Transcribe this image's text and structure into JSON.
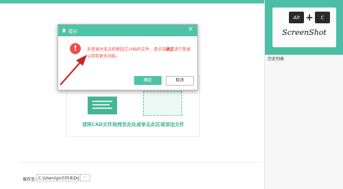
{
  "colors": {
    "accent": "#4fc3a8",
    "error": "#ef4d4d",
    "arrow": "#c82424"
  },
  "sidebar": {
    "logo": {
      "key_alt": "Alt",
      "key_c": "C",
      "plus": "+",
      "text": "ScreenShot"
    },
    "history_label": "历史列表"
  },
  "drop_area": {
    "text": "请将CAD文件拖拽至此处或单击此区域添加文件"
  },
  "save": {
    "label": "保存至:",
    "path": "C:\\Users\\pc0359\\Docu",
    "browse_label": "···"
  },
  "dialog": {
    "title": "提示",
    "icon": "exclamation-icon",
    "message_before": "未登录时无法转换超过1MB的文件，请点击",
    "message_highlight": "确定",
    "message_after": "进行登录以获取更多功能。",
    "confirm_label": "确定",
    "cancel_label": "取消"
  }
}
